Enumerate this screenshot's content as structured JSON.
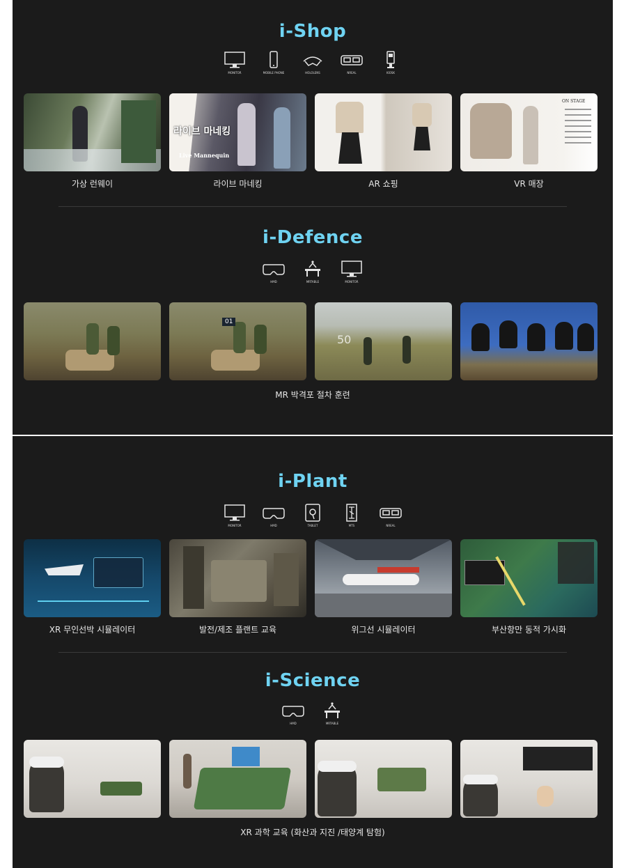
{
  "sections": {
    "shop": {
      "title": "i-Shop",
      "devices": [
        {
          "icon": "monitor-icon",
          "label": "MONITOR"
        },
        {
          "icon": "mobile-phone-icon",
          "label": "MOBILE PHONE"
        },
        {
          "icon": "hololens-icon",
          "label": "HOLOLENS"
        },
        {
          "icon": "nreal-icon",
          "label": "Nreal"
        },
        {
          "icon": "kiosk-icon",
          "label": "KIOSK"
        }
      ],
      "tiles": [
        {
          "caption": "가상 런웨이"
        },
        {
          "caption": "라이브 마네킹",
          "overlay_title": "라이브 마네킹",
          "overlay_sub": "Live Mannequin"
        },
        {
          "caption": "AR 쇼핑"
        },
        {
          "caption": "VR 매장",
          "overlay_title": "ON STAGE"
        }
      ]
    },
    "defence": {
      "title": "i-Defence",
      "devices": [
        {
          "icon": "hmd-icon",
          "label": "HMD"
        },
        {
          "icon": "mr-table-icon",
          "label": "MRTable"
        },
        {
          "icon": "monitor-icon",
          "label": "MONITOR"
        }
      ],
      "group_caption": "MR 박격포 절차 훈련",
      "tiles": [
        {
          "overlay": ""
        },
        {
          "overlay": "01"
        },
        {
          "overlay": "50"
        },
        {
          "overlay": ""
        }
      ]
    },
    "plant": {
      "title": "i-Plant",
      "devices": [
        {
          "icon": "monitor-icon",
          "label": "MONITOR"
        },
        {
          "icon": "hmd-icon",
          "label": "HMD"
        },
        {
          "icon": "tablet-icon",
          "label": "TABLET"
        },
        {
          "icon": "mts-icon",
          "label": "MTS"
        },
        {
          "icon": "nreal-icon",
          "label": "Nreal"
        }
      ],
      "tiles": [
        {
          "caption": "XR 무인선박 시뮬레이터"
        },
        {
          "caption": "발전/제조 플랜트 교육"
        },
        {
          "caption": "위그선 시뮬레이터"
        },
        {
          "caption": "부산항만 동적 가시화"
        }
      ]
    },
    "science": {
      "title": "i-Science",
      "devices": [
        {
          "icon": "hmd-icon",
          "label": "HMD"
        },
        {
          "icon": "mr-table-icon",
          "label": "MRTable"
        }
      ],
      "group_caption": "XR 과학 교육 (화산과 지진 /태양계 탐험)"
    }
  },
  "colors": {
    "panel_bg": "#1b1b1b",
    "title_accent": "#6fd3f2",
    "caption_text": "#e6e6e6"
  }
}
